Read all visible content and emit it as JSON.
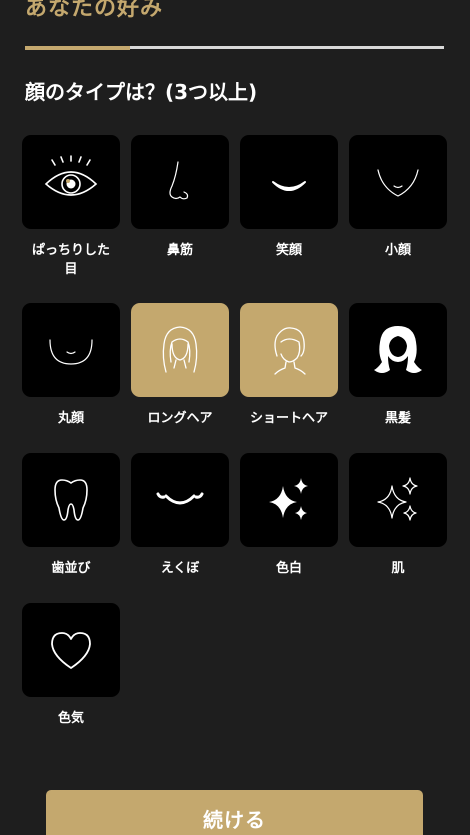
{
  "header": {
    "title": "あなたの好み",
    "progress": 0.25
  },
  "question": "顔のタイプは？(3つ以上)",
  "options": [
    {
      "label": "ぱっちりした目",
      "icon": "eye-icon",
      "selected": true
    },
    {
      "label": "鼻筋",
      "icon": "nose-icon",
      "selected": false
    },
    {
      "label": "笑顔",
      "icon": "smile-icon",
      "selected": false
    },
    {
      "label": "小顔",
      "icon": "small-face-icon",
      "selected": false
    },
    {
      "label": "丸顔",
      "icon": "round-face-icon",
      "selected": false
    },
    {
      "label": "ロングヘア",
      "icon": "long-hair-icon",
      "selected": true
    },
    {
      "label": "ショートヘア",
      "icon": "short-hair-icon",
      "selected": true
    },
    {
      "label": "黒髪",
      "icon": "black-hair-icon",
      "selected": false
    },
    {
      "label": "歯並び",
      "icon": "tooth-icon",
      "selected": false
    },
    {
      "label": "えくぼ",
      "icon": "dimple-smile-icon",
      "selected": false
    },
    {
      "label": "色白",
      "icon": "sparkle-filled-icon",
      "selected": false
    },
    {
      "label": "肌",
      "icon": "sparkle-outline-icon",
      "selected": false
    },
    {
      "label": "色気",
      "icon": "heart-icon",
      "selected": false
    }
  ],
  "continue_label": "続ける",
  "colors": {
    "accent": "#c4a86e",
    "background": "#1e1e1e",
    "tile": "#000000",
    "text": "#ffffff"
  }
}
